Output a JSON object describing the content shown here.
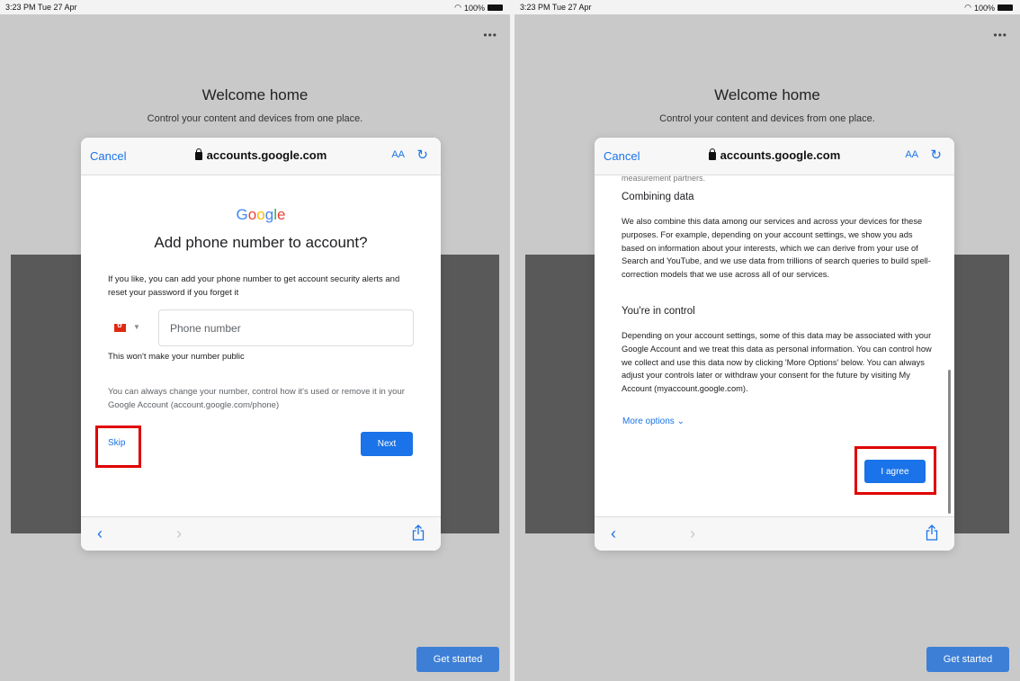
{
  "status_bar": {
    "time": "3:23 PM  Tue 27 Apr",
    "battery": "100%"
  },
  "background_page": {
    "title": "Welcome home",
    "subtitle": "Control your content and devices from one place.",
    "more_menu": "•••",
    "get_started": "Get started"
  },
  "browser_sheet": {
    "cancel": "Cancel",
    "url": "accounts.google.com",
    "text_size": "AA",
    "reload_glyph": "↻",
    "back_glyph": "‹",
    "forward_glyph": "›"
  },
  "left_panel": {
    "logo": {
      "G": "G",
      "o1": "o",
      "o2": "o",
      "g": "g",
      "l": "l",
      "e": "e"
    },
    "title": "Add phone number to account?",
    "intro": "If you like, you can add your phone number to get account security alerts and reset your password if you forget it",
    "country_caret": "▼",
    "phone_placeholder": "Phone number",
    "not_public": "This won't make your number public",
    "change_note": "You can always change your number, control how it's used or remove it in your Google Account (account.google.com/phone)",
    "skip": "Skip",
    "next": "Next"
  },
  "right_panel": {
    "cut_text": "measurement partners.",
    "combining_heading": "Combining data",
    "combining_text": "We also combine this data among our services and across your devices for these purposes. For example, depending on your account settings, we show you ads based on information about your interests, which we can derive from your use of Search and YouTube, and we use data from trillions of search queries to build spell-correction models that we use across all of our services.",
    "control_heading": "You're in control",
    "control_text": "Depending on your account settings, some of this data may be associated with your Google Account and we treat this data as personal information. You can control how we collect and use this data now by clicking 'More Options' below. You can always adjust your controls later or withdraw your consent for the future by visiting My Account (myaccount.google.com).",
    "more_options": "More options ⌄",
    "agree": "I agree"
  },
  "colors": {
    "accent": "#1a73e8",
    "highlight_box": "#e00000",
    "get_started_bg": "#3d7fd6"
  }
}
